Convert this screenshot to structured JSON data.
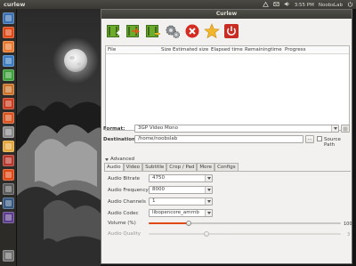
{
  "topbar": {
    "app_name": "curlew",
    "time": "3:55 PM",
    "user": "NoobsLab"
  },
  "window": {
    "title": "Curlew"
  },
  "toolbar": {
    "buttons": [
      {
        "name": "add-file-icon"
      },
      {
        "name": "convert-icon"
      },
      {
        "name": "remove-file-icon"
      },
      {
        "name": "settings-gears-icon"
      },
      {
        "name": "stop-icon"
      },
      {
        "name": "star-icon"
      },
      {
        "name": "quit-icon"
      }
    ]
  },
  "file_list": {
    "columns": [
      "File",
      "Size",
      "Estimated size",
      "Elapsed time",
      "Remainingtime",
      "Progress"
    ]
  },
  "format": {
    "label": "Format:",
    "value": "3GP Video Mono"
  },
  "destination": {
    "label": "Destination:",
    "value": "/home/noobslab",
    "browse_label": "...",
    "source_path_label": "Source Path"
  },
  "advanced": {
    "label": "Advanced",
    "tabs": [
      "Audio",
      "Video",
      "Subtitle",
      "Crop / Pad",
      "More",
      "Configs"
    ],
    "active_tab": "Audio"
  },
  "audio": {
    "bitrate_label": "Audio Bitrate",
    "bitrate_value": "4750",
    "frequency_label": "Audio Frequency",
    "frequency_value": "8000",
    "channels_label": "Audio Channels",
    "channels_value": "1",
    "codec_label": "Audio Codec",
    "codec_value": "libopencore_amrnb",
    "volume_label": "Volume (%)",
    "volume_value": "100",
    "volume_fraction": 0.21,
    "quality_label": "Audio Quality",
    "quality_value": "3",
    "quality_fraction": 0.3
  },
  "colors": {
    "accent": "#dd4814",
    "panel": "#3c3b37",
    "window_bg": "#f2f1f0"
  }
}
